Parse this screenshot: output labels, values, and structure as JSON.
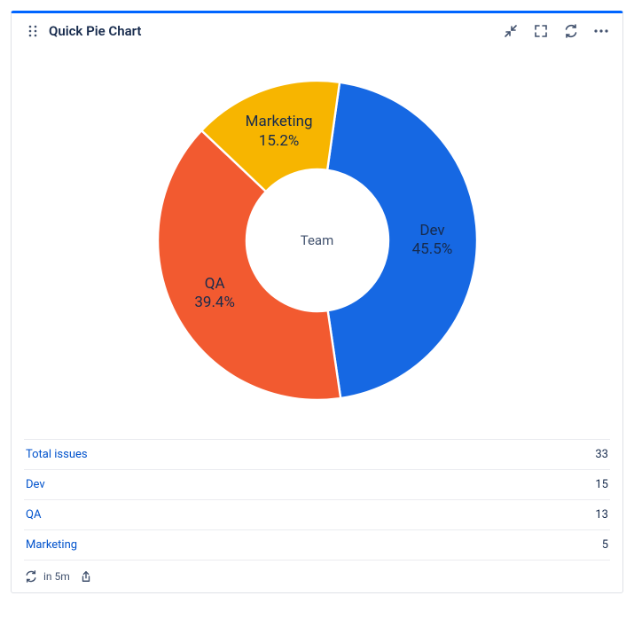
{
  "header": {
    "title": "Quick Pie Chart"
  },
  "chart_data": {
    "type": "pie",
    "title": "Team",
    "series": [
      {
        "name": "Dev",
        "value": 15,
        "percent": "45.5%",
        "color": "#1668e3"
      },
      {
        "name": "QA",
        "value": 13,
        "percent": "39.4%",
        "color": "#f25a30"
      },
      {
        "name": "Marketing",
        "value": 5,
        "percent": "15.2%",
        "color": "#f7b500"
      }
    ]
  },
  "table": {
    "total_label": "Total issues",
    "total_value": "33",
    "rows": [
      {
        "label": "Dev",
        "value": "15"
      },
      {
        "label": "QA",
        "value": "13"
      },
      {
        "label": "Marketing",
        "value": "5"
      }
    ]
  },
  "footer": {
    "refresh_text": "in 5m"
  }
}
